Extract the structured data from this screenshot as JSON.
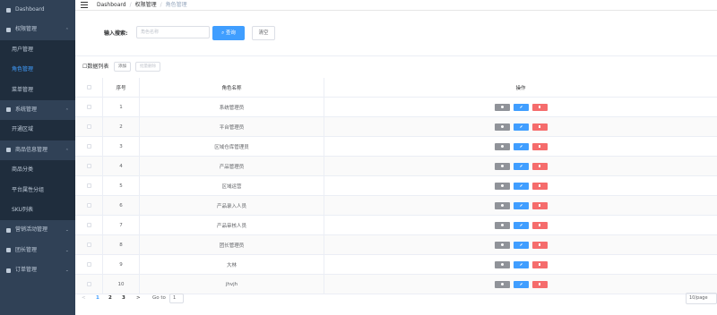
{
  "sidebar": {
    "items": [
      {
        "label": "Dashboard",
        "icon": "dashboard-icon",
        "type": "top"
      },
      {
        "label": "权限管理",
        "icon": "lock-icon",
        "type": "top",
        "arrow": "^"
      },
      {
        "label": "用户管理",
        "type": "sub"
      },
      {
        "label": "角色管理",
        "type": "sub",
        "active": true
      },
      {
        "label": "菜单管理",
        "type": "sub"
      },
      {
        "label": "系统管理",
        "icon": "gear-icon",
        "type": "top",
        "arrow": "^"
      },
      {
        "label": "开通区域",
        "type": "sub"
      },
      {
        "label": "商品信息管理",
        "icon": "goods-icon",
        "type": "top",
        "arrow": "^"
      },
      {
        "label": "商品分类",
        "type": "sub"
      },
      {
        "label": "平台属性分组",
        "type": "sub"
      },
      {
        "label": "SKU列表",
        "type": "sub"
      },
      {
        "label": "营销活动管理",
        "icon": "marketing-icon",
        "type": "top",
        "arrow": "v"
      },
      {
        "label": "团长管理",
        "icon": "leader-icon",
        "type": "top",
        "arrow": "v"
      },
      {
        "label": "订单管理",
        "icon": "order-icon",
        "type": "top",
        "arrow": "v"
      }
    ]
  },
  "breadcrumb": {
    "home": "Dashboard",
    "parent": "权限管理",
    "current": "角色管理",
    "separator": "/"
  },
  "search": {
    "label": "输入搜索:",
    "placeholder": "角色名称",
    "query_label": "查询",
    "clear_label": "清空"
  },
  "list": {
    "title": "数据列表",
    "add_label": "添加",
    "batch_delete_label": "批量删除"
  },
  "table": {
    "headers": {
      "index": "序号",
      "name": "角色名称",
      "ops": "操作"
    },
    "rows": [
      {
        "index": "1",
        "name": "系统管理员"
      },
      {
        "index": "2",
        "name": "平台管理员"
      },
      {
        "index": "3",
        "name": "区域仓库管理员"
      },
      {
        "index": "4",
        "name": "产品管理员"
      },
      {
        "index": "5",
        "name": "区域运营"
      },
      {
        "index": "6",
        "name": "产品录入人员"
      },
      {
        "index": "7",
        "name": "产品审核人员"
      },
      {
        "index": "8",
        "name": "团长管理员"
      },
      {
        "index": "9",
        "name": "大林"
      },
      {
        "index": "10",
        "name": "jhvjh"
      }
    ]
  },
  "pagination": {
    "prev": "<",
    "next": ">",
    "pages": [
      "1",
      "2",
      "3"
    ],
    "current_page": "1",
    "goto_label": "Go to",
    "goto_value": "1",
    "page_size": "10/page"
  },
  "colors": {
    "sidebar_bg": "#304156",
    "primary": "#409eff",
    "danger": "#f56c6c",
    "info": "#909399"
  }
}
